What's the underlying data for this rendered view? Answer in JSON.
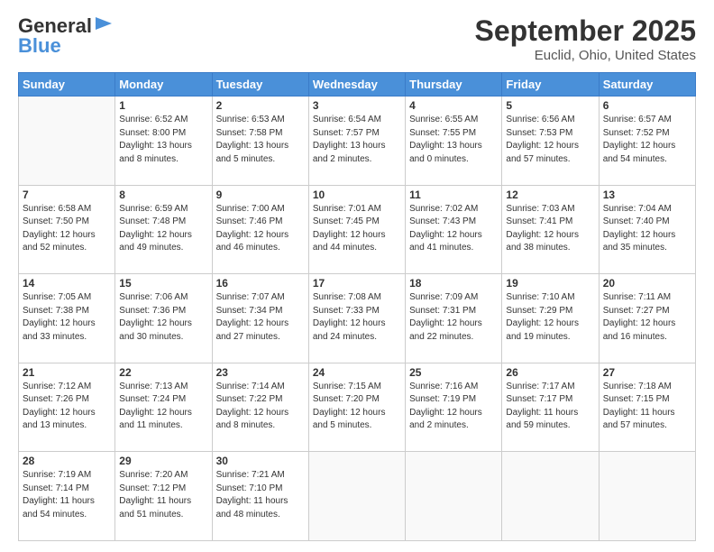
{
  "header": {
    "logo_general": "General",
    "logo_blue": "Blue",
    "month_title": "September 2025",
    "location": "Euclid, Ohio, United States"
  },
  "weekdays": [
    "Sunday",
    "Monday",
    "Tuesday",
    "Wednesday",
    "Thursday",
    "Friday",
    "Saturday"
  ],
  "weeks": [
    [
      {
        "day": "",
        "sunrise": "",
        "sunset": "",
        "daylight": ""
      },
      {
        "day": "1",
        "sunrise": "Sunrise: 6:52 AM",
        "sunset": "Sunset: 8:00 PM",
        "daylight": "Daylight: 13 hours and 8 minutes."
      },
      {
        "day": "2",
        "sunrise": "Sunrise: 6:53 AM",
        "sunset": "Sunset: 7:58 PM",
        "daylight": "Daylight: 13 hours and 5 minutes."
      },
      {
        "day": "3",
        "sunrise": "Sunrise: 6:54 AM",
        "sunset": "Sunset: 7:57 PM",
        "daylight": "Daylight: 13 hours and 2 minutes."
      },
      {
        "day": "4",
        "sunrise": "Sunrise: 6:55 AM",
        "sunset": "Sunset: 7:55 PM",
        "daylight": "Daylight: 13 hours and 0 minutes."
      },
      {
        "day": "5",
        "sunrise": "Sunrise: 6:56 AM",
        "sunset": "Sunset: 7:53 PM",
        "daylight": "Daylight: 12 hours and 57 minutes."
      },
      {
        "day": "6",
        "sunrise": "Sunrise: 6:57 AM",
        "sunset": "Sunset: 7:52 PM",
        "daylight": "Daylight: 12 hours and 54 minutes."
      }
    ],
    [
      {
        "day": "7",
        "sunrise": "Sunrise: 6:58 AM",
        "sunset": "Sunset: 7:50 PM",
        "daylight": "Daylight: 12 hours and 52 minutes."
      },
      {
        "day": "8",
        "sunrise": "Sunrise: 6:59 AM",
        "sunset": "Sunset: 7:48 PM",
        "daylight": "Daylight: 12 hours and 49 minutes."
      },
      {
        "day": "9",
        "sunrise": "Sunrise: 7:00 AM",
        "sunset": "Sunset: 7:46 PM",
        "daylight": "Daylight: 12 hours and 46 minutes."
      },
      {
        "day": "10",
        "sunrise": "Sunrise: 7:01 AM",
        "sunset": "Sunset: 7:45 PM",
        "daylight": "Daylight: 12 hours and 44 minutes."
      },
      {
        "day": "11",
        "sunrise": "Sunrise: 7:02 AM",
        "sunset": "Sunset: 7:43 PM",
        "daylight": "Daylight: 12 hours and 41 minutes."
      },
      {
        "day": "12",
        "sunrise": "Sunrise: 7:03 AM",
        "sunset": "Sunset: 7:41 PM",
        "daylight": "Daylight: 12 hours and 38 minutes."
      },
      {
        "day": "13",
        "sunrise": "Sunrise: 7:04 AM",
        "sunset": "Sunset: 7:40 PM",
        "daylight": "Daylight: 12 hours and 35 minutes."
      }
    ],
    [
      {
        "day": "14",
        "sunrise": "Sunrise: 7:05 AM",
        "sunset": "Sunset: 7:38 PM",
        "daylight": "Daylight: 12 hours and 33 minutes."
      },
      {
        "day": "15",
        "sunrise": "Sunrise: 7:06 AM",
        "sunset": "Sunset: 7:36 PM",
        "daylight": "Daylight: 12 hours and 30 minutes."
      },
      {
        "day": "16",
        "sunrise": "Sunrise: 7:07 AM",
        "sunset": "Sunset: 7:34 PM",
        "daylight": "Daylight: 12 hours and 27 minutes."
      },
      {
        "day": "17",
        "sunrise": "Sunrise: 7:08 AM",
        "sunset": "Sunset: 7:33 PM",
        "daylight": "Daylight: 12 hours and 24 minutes."
      },
      {
        "day": "18",
        "sunrise": "Sunrise: 7:09 AM",
        "sunset": "Sunset: 7:31 PM",
        "daylight": "Daylight: 12 hours and 22 minutes."
      },
      {
        "day": "19",
        "sunrise": "Sunrise: 7:10 AM",
        "sunset": "Sunset: 7:29 PM",
        "daylight": "Daylight: 12 hours and 19 minutes."
      },
      {
        "day": "20",
        "sunrise": "Sunrise: 7:11 AM",
        "sunset": "Sunset: 7:27 PM",
        "daylight": "Daylight: 12 hours and 16 minutes."
      }
    ],
    [
      {
        "day": "21",
        "sunrise": "Sunrise: 7:12 AM",
        "sunset": "Sunset: 7:26 PM",
        "daylight": "Daylight: 12 hours and 13 minutes."
      },
      {
        "day": "22",
        "sunrise": "Sunrise: 7:13 AM",
        "sunset": "Sunset: 7:24 PM",
        "daylight": "Daylight: 12 hours and 11 minutes."
      },
      {
        "day": "23",
        "sunrise": "Sunrise: 7:14 AM",
        "sunset": "Sunset: 7:22 PM",
        "daylight": "Daylight: 12 hours and 8 minutes."
      },
      {
        "day": "24",
        "sunrise": "Sunrise: 7:15 AM",
        "sunset": "Sunset: 7:20 PM",
        "daylight": "Daylight: 12 hours and 5 minutes."
      },
      {
        "day": "25",
        "sunrise": "Sunrise: 7:16 AM",
        "sunset": "Sunset: 7:19 PM",
        "daylight": "Daylight: 12 hours and 2 minutes."
      },
      {
        "day": "26",
        "sunrise": "Sunrise: 7:17 AM",
        "sunset": "Sunset: 7:17 PM",
        "daylight": "Daylight: 11 hours and 59 minutes."
      },
      {
        "day": "27",
        "sunrise": "Sunrise: 7:18 AM",
        "sunset": "Sunset: 7:15 PM",
        "daylight": "Daylight: 11 hours and 57 minutes."
      }
    ],
    [
      {
        "day": "28",
        "sunrise": "Sunrise: 7:19 AM",
        "sunset": "Sunset: 7:14 PM",
        "daylight": "Daylight: 11 hours and 54 minutes."
      },
      {
        "day": "29",
        "sunrise": "Sunrise: 7:20 AM",
        "sunset": "Sunset: 7:12 PM",
        "daylight": "Daylight: 11 hours and 51 minutes."
      },
      {
        "day": "30",
        "sunrise": "Sunrise: 7:21 AM",
        "sunset": "Sunset: 7:10 PM",
        "daylight": "Daylight: 11 hours and 48 minutes."
      },
      {
        "day": "",
        "sunrise": "",
        "sunset": "",
        "daylight": ""
      },
      {
        "day": "",
        "sunrise": "",
        "sunset": "",
        "daylight": ""
      },
      {
        "day": "",
        "sunrise": "",
        "sunset": "",
        "daylight": ""
      },
      {
        "day": "",
        "sunrise": "",
        "sunset": "",
        "daylight": ""
      }
    ]
  ]
}
